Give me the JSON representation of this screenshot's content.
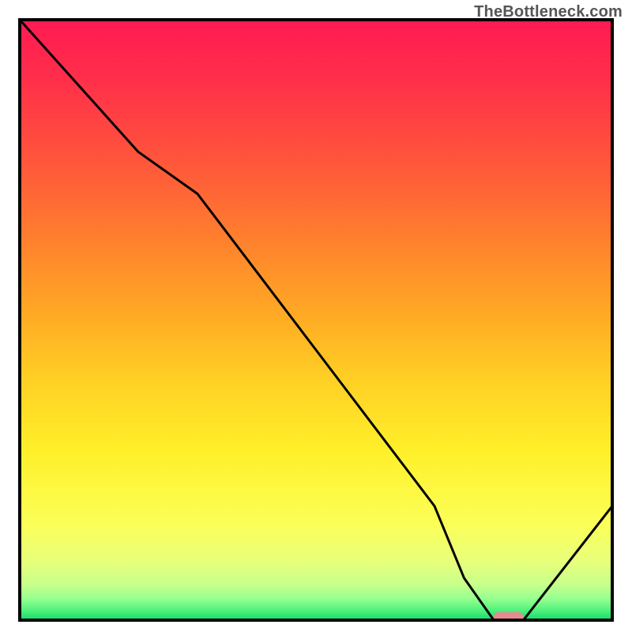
{
  "watermark": "TheBottleneck.com",
  "chart_data": {
    "type": "line",
    "title": "",
    "xlabel": "",
    "ylabel": "",
    "xlim": [
      0,
      100
    ],
    "ylim": [
      0,
      100
    ],
    "categories": [
      0,
      10,
      20,
      30,
      40,
      50,
      60,
      70,
      75,
      80,
      85,
      100
    ],
    "series": [
      {
        "name": "bottleneck-curve",
        "values": [
          100,
          89,
          78,
          71,
          58,
          45,
          32,
          19,
          7,
          0,
          0,
          19
        ]
      }
    ],
    "marker": {
      "x_start": 80,
      "x_end": 85,
      "y": 0,
      "color": "#e98992"
    },
    "gradient_stops": [
      {
        "offset": 0.0,
        "color": "#ff1a52"
      },
      {
        "offset": 0.1,
        "color": "#ff2f4a"
      },
      {
        "offset": 0.2,
        "color": "#ff4b3f"
      },
      {
        "offset": 0.3,
        "color": "#ff6a34"
      },
      {
        "offset": 0.4,
        "color": "#ff8b2a"
      },
      {
        "offset": 0.5,
        "color": "#ffad24"
      },
      {
        "offset": 0.6,
        "color": "#ffd024"
      },
      {
        "offset": 0.72,
        "color": "#fff02a"
      },
      {
        "offset": 0.84,
        "color": "#fbff58"
      },
      {
        "offset": 0.9,
        "color": "#e9ff7a"
      },
      {
        "offset": 0.94,
        "color": "#c8ff8a"
      },
      {
        "offset": 0.965,
        "color": "#93ff90"
      },
      {
        "offset": 0.985,
        "color": "#4bf07a"
      },
      {
        "offset": 1.0,
        "color": "#12d96a"
      }
    ],
    "frame_color": "#000000",
    "line_color": "#000000",
    "line_width": 3
  }
}
